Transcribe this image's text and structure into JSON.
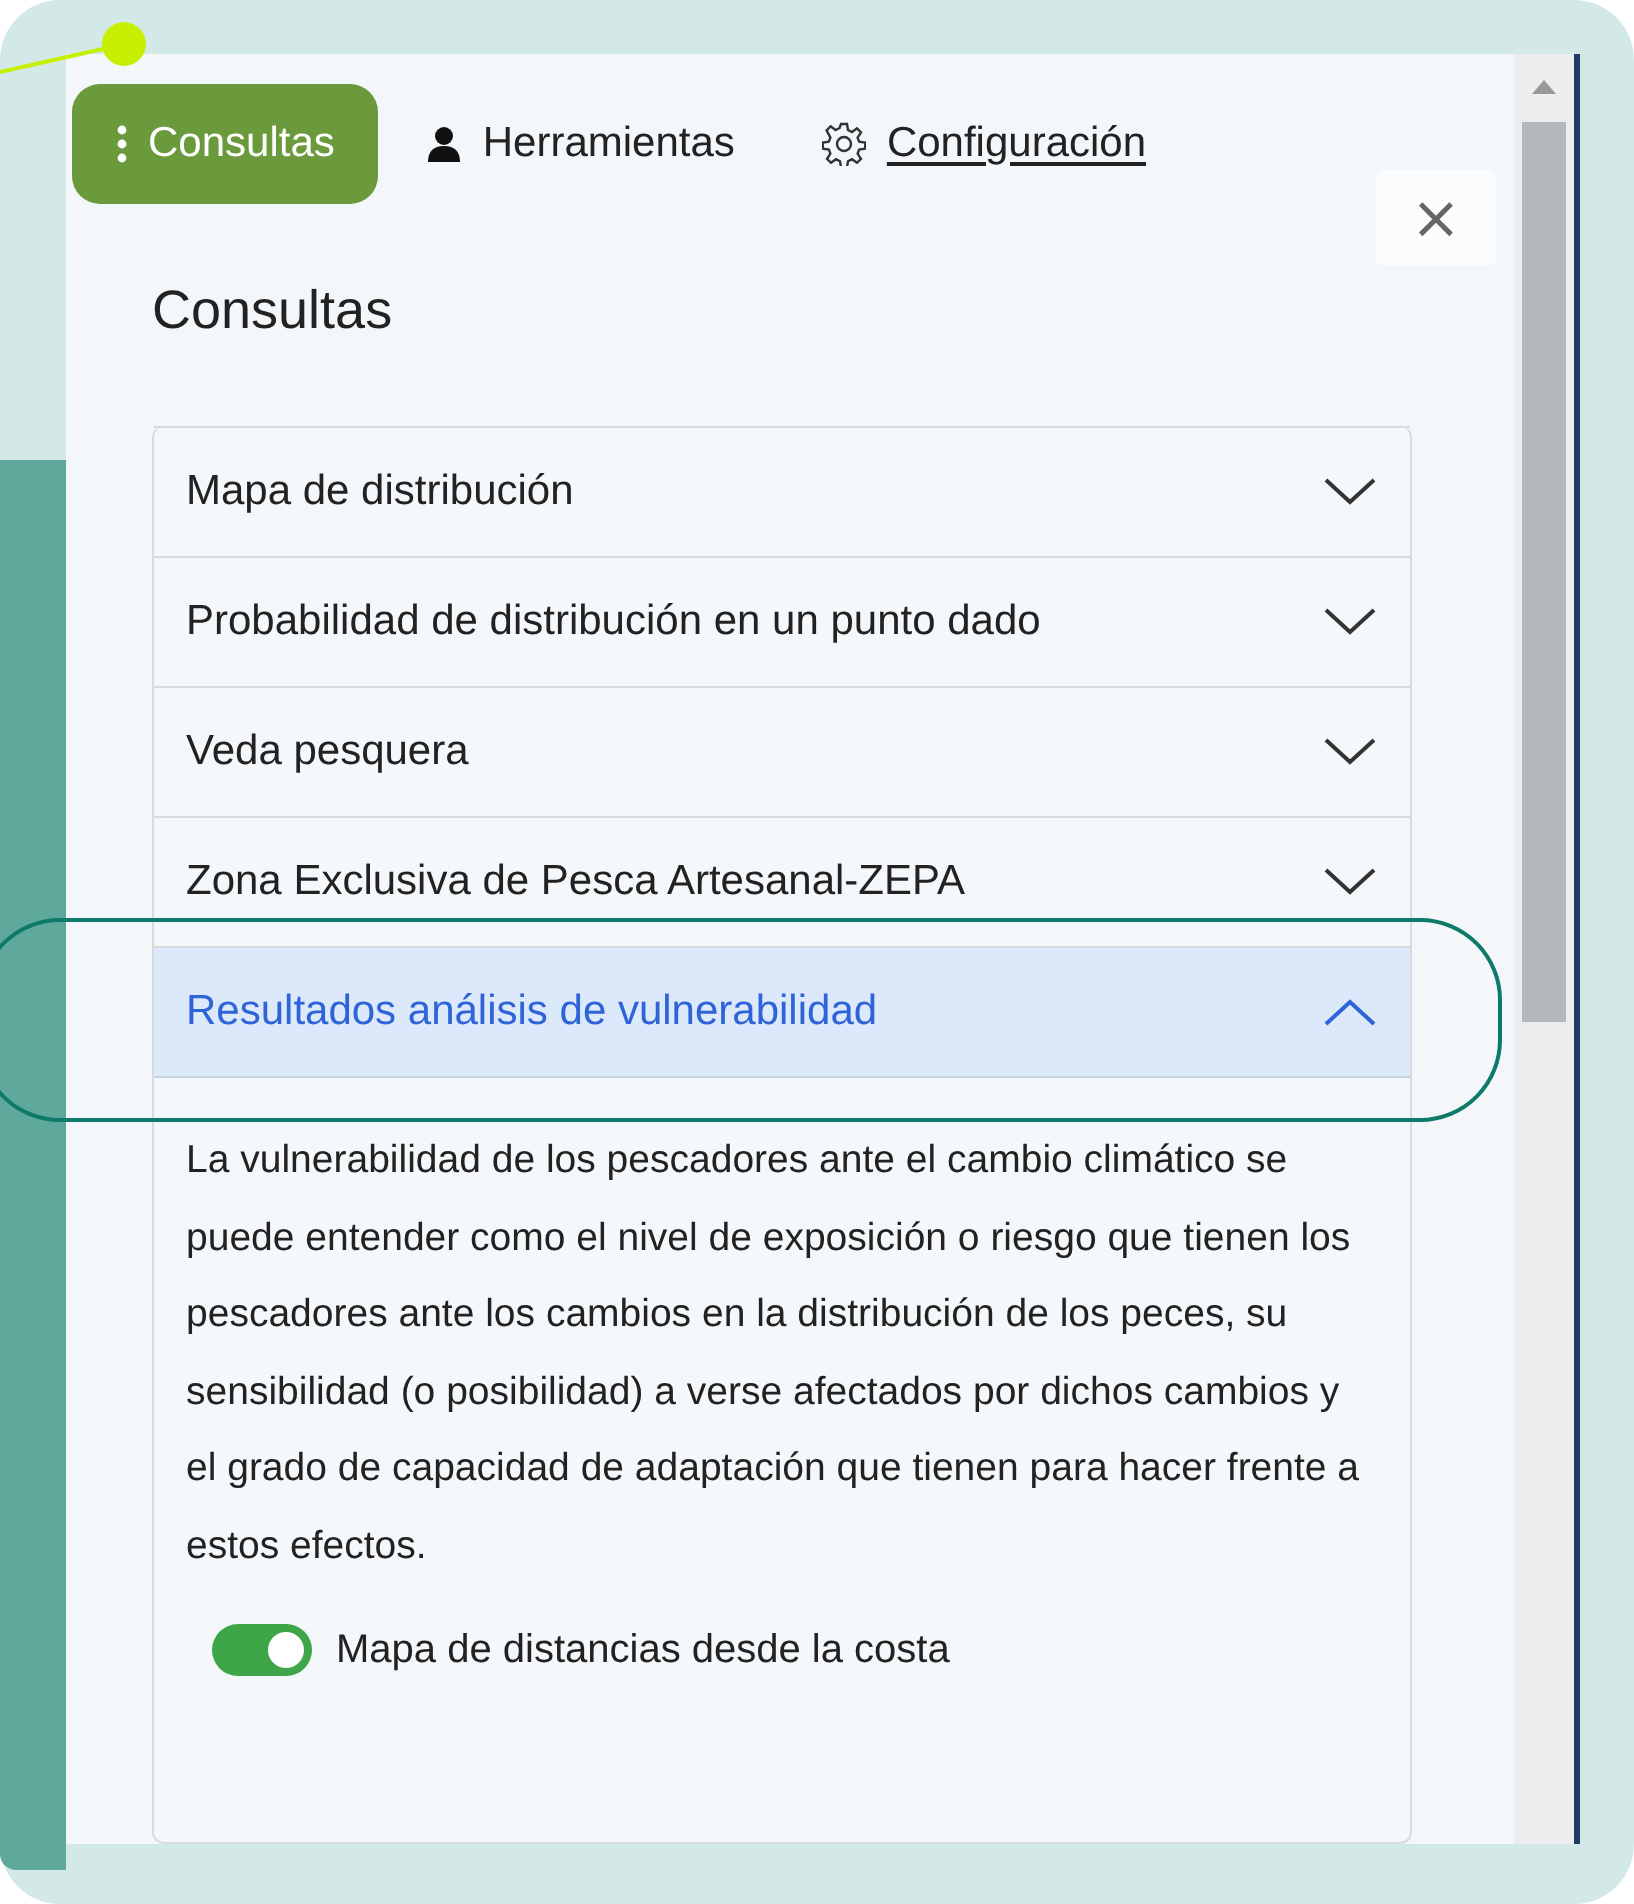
{
  "tabs": [
    {
      "label": "Consultas",
      "kind": "menu",
      "selected": true,
      "underlined": false
    },
    {
      "label": "Herramientas",
      "kind": "person",
      "selected": false,
      "underlined": false
    },
    {
      "label": "Configuración",
      "kind": "gear",
      "selected": false,
      "underlined": true
    }
  ],
  "close": {
    "label": "×"
  },
  "heading": "Consultas",
  "accordion": [
    {
      "label": "Mapa de distribución",
      "expanded": false
    },
    {
      "label": "Probabilidad de distribución en un punto dado",
      "expanded": false
    },
    {
      "label": "Veda pesquera",
      "expanded": false
    },
    {
      "label": "Zona Exclusiva de Pesca Artesanal-ZEPA",
      "expanded": false
    },
    {
      "label": "Resultados análisis de vulnerabilidad",
      "expanded": true,
      "description": "La vulnerabilidad de los pescadores ante el cambio climático se puede entender como el nivel de exposición o riesgo que tienen los pescadores ante los cambios en la distribución de los peces, su sensibilidad (o posibilidad) a verse afectados por dichos cambios y el grado de capacidad de adaptación que tienen para hacer frente a estos efectos.",
      "toggle": {
        "label": "Mapa de distancias desde la costa",
        "on": true
      }
    }
  ]
}
